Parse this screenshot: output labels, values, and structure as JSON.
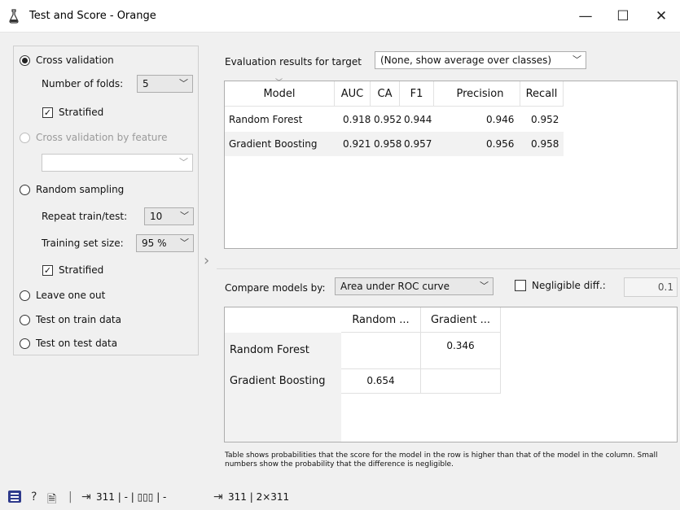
{
  "window": {
    "title": "Test and Score - Orange",
    "minimize_glyph": "—",
    "maximize_glyph": "☐",
    "close_glyph": "✕"
  },
  "sampling": {
    "cross_validation": {
      "label": "Cross validation",
      "selected": true
    },
    "folds_label": "Number of folds:",
    "folds_value": "5",
    "stratified_label": "Stratified",
    "cv_by_feature": {
      "label": "Cross validation by feature",
      "enabled": false
    },
    "feature_value": "",
    "random_sampling": {
      "label": "Random sampling",
      "selected": false
    },
    "repeat_label": "Repeat train/test:",
    "repeat_value": "10",
    "train_size_label": "Training set size:",
    "train_size_value": "95 %",
    "stratified2_label": "Stratified",
    "leave_one_out": "Leave one out",
    "test_on_train": "Test on train data",
    "test_on_test": "Test on test data"
  },
  "evaluation": {
    "target_label": "Evaluation results for target",
    "target_value": "(None, show average over classes)",
    "columns": [
      "Model",
      "AUC",
      "CA",
      "F1",
      "Precision",
      "Recall"
    ],
    "rows": [
      [
        "Random Forest",
        "0.918",
        "0.952",
        "0.944",
        "0.946",
        "0.952"
      ],
      [
        "Gradient Boosting",
        "0.921",
        "0.958",
        "0.957",
        "0.956",
        "0.958"
      ]
    ]
  },
  "comparison": {
    "compare_label": "Compare models by:",
    "compare_value": "Area under ROC curve",
    "negligible_label": "Negligible diff.:",
    "negligible_value": "0.1",
    "col_headers": [
      "Random ...",
      "Gradient ..."
    ],
    "row_headers": [
      "Random Forest",
      "Gradient Boosting"
    ],
    "values": [
      [
        "",
        "0.346"
      ],
      [
        "0.654",
        ""
      ]
    ],
    "note": "Table shows probabilities that the score for the model in the row is higher than that of the model in the column. Small numbers show the probability that the difference is negligible."
  },
  "statusbar": {
    "input_count": "311 | - | ▯▯▯ | -",
    "output_count": "311 | 2×311"
  }
}
